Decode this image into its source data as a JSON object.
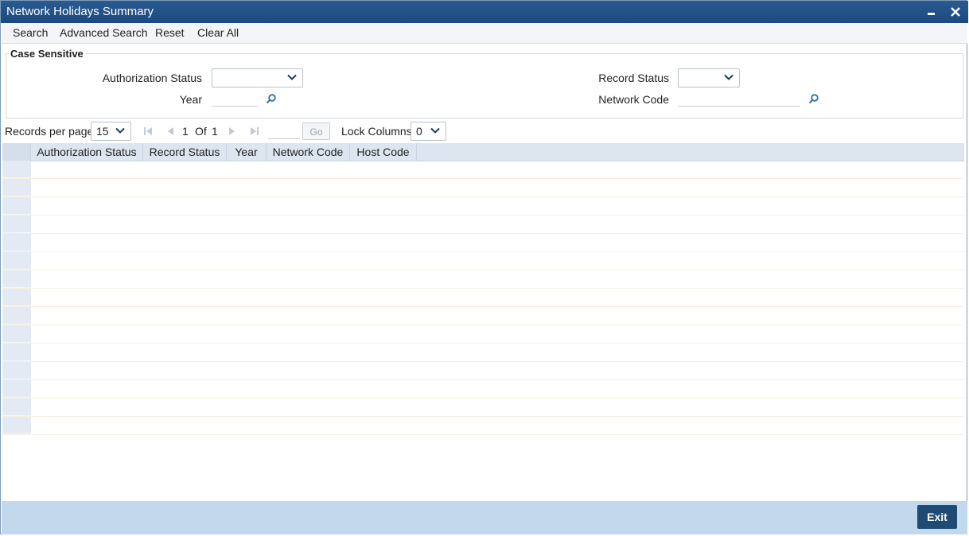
{
  "window": {
    "title": "Network Holidays Summary"
  },
  "toolbar": {
    "search": "Search",
    "advanced_search": "Advanced Search",
    "reset": "Reset",
    "clear_all": "Clear All"
  },
  "criteria": {
    "legend": "Case Sensitive",
    "authorization_status_label": "Authorization Status",
    "authorization_status_value": "",
    "year_label": "Year",
    "year_value": "",
    "record_status_label": "Record Status",
    "record_status_value": "",
    "network_code_label": "Network Code",
    "network_code_value": ""
  },
  "pager": {
    "records_per_page_label": "Records per page",
    "records_per_page": "15",
    "current_page": "1",
    "of_label": "Of",
    "total_pages": "1",
    "goto_value": "",
    "go_label": "Go",
    "lock_columns_label": "Lock Columns",
    "lock_columns": "0"
  },
  "grid": {
    "columns": [
      "Authorization Status",
      "Record Status",
      "Year",
      "Network Code",
      "Host Code"
    ],
    "empty_rows": 15
  },
  "footer": {
    "exit_label": "Exit"
  },
  "colors": {
    "title_bar": "#1c4a80",
    "footer": "#c2d8ec",
    "exit_button": "#1f4a73",
    "lookup_icon": "#2f6fb3"
  },
  "icons": {
    "minimize": "minimize-icon",
    "close": "close-icon",
    "dropdown": "chevron-down-icon",
    "lookup": "search-icon",
    "first": "first-page-icon",
    "prev": "previous-page-icon",
    "next": "next-page-icon",
    "last": "last-page-icon"
  }
}
